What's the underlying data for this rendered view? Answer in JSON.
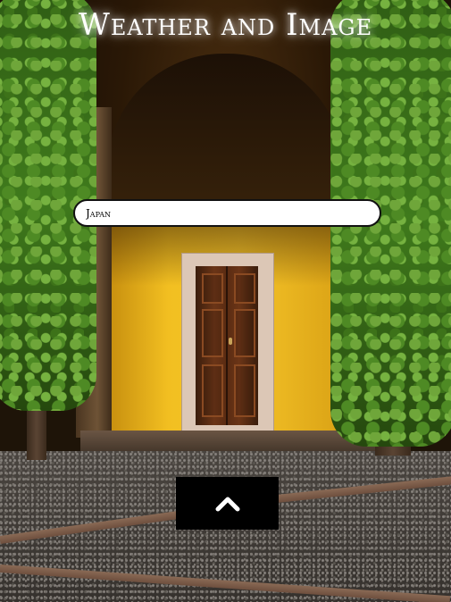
{
  "page": {
    "title": "Weather and Image"
  },
  "search": {
    "value": "Japan",
    "placeholder": ""
  },
  "controls": {
    "scroll_up_icon": "chevron-up-icon"
  },
  "colors": {
    "title_text": "#ffffff",
    "input_background": "#ffffff",
    "input_border": "#111111",
    "button_background": "#000000",
    "button_icon": "#ffffff",
    "wall_yellow": "#f2bf21",
    "ivy_green": "#3f7a1c"
  }
}
